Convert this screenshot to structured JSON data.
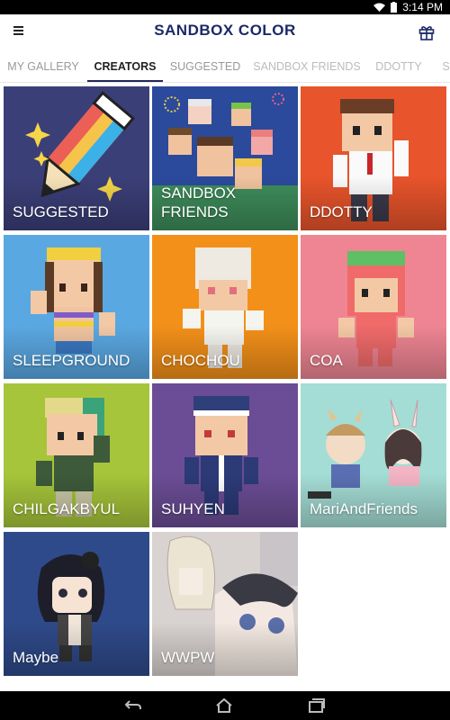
{
  "status": {
    "time": "3:14 PM"
  },
  "app": {
    "title": "SANDBOX COLOR"
  },
  "tabs": [
    {
      "label": "MY GALLERY"
    },
    {
      "label": "CREATORS"
    },
    {
      "label": "SUGGESTED"
    },
    {
      "label": "SANDBOX FRIENDS"
    },
    {
      "label": "DDOTTY"
    },
    {
      "label": "SL"
    }
  ],
  "cards": [
    {
      "label": "SUGGESTED",
      "color": "#3b3f78"
    },
    {
      "label": "SANDBOX\nFRIENDS",
      "color": "#2b4a9c"
    },
    {
      "label": "DDOTTY",
      "color": "#e8542b"
    },
    {
      "label": "SLEEPGROUND",
      "color": "#5aa8e2"
    },
    {
      "label": "CHOCHOU",
      "color": "#f39019"
    },
    {
      "label": "COA",
      "color": "#ef8593"
    },
    {
      "label": "CHILGAKBYUL",
      "color": "#a6c53a"
    },
    {
      "label": "SUHYEN",
      "color": "#6b4d95"
    },
    {
      "label": "MariAndFriends",
      "color": "#a4ddd5"
    },
    {
      "label": "Maybe",
      "color": "#2f4a8a"
    },
    {
      "label": "WWPW",
      "color": "#d8d2d0"
    }
  ],
  "colors": {
    "tab_indicator": "#22285a",
    "title": "#1b2a66"
  }
}
